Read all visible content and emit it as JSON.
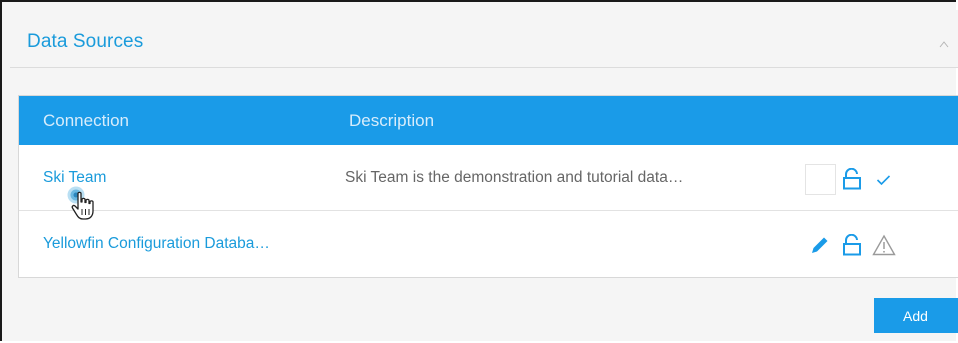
{
  "panel": {
    "title": "Data Sources"
  },
  "table": {
    "headers": {
      "connection": "Connection",
      "description": "Description"
    },
    "rows": [
      {
        "connection": "Ski Team",
        "description": "Ski Team is the demonstration and tutorial data…",
        "icons": [
          "checkbox",
          "unlock-icon",
          "check-icon"
        ]
      },
      {
        "connection": "Yellowfin Configuration Databa…",
        "description": "",
        "icons": [
          "pencil-icon",
          "unlock-icon",
          "warning-icon"
        ]
      }
    ]
  },
  "actions": {
    "add_label": "Add"
  },
  "colors": {
    "accent": "#1a9be8",
    "link": "#1a9bdb",
    "header_text": "#d7ecfb",
    "muted_text": "#666666",
    "panel_bg": "#f5f5f5"
  }
}
